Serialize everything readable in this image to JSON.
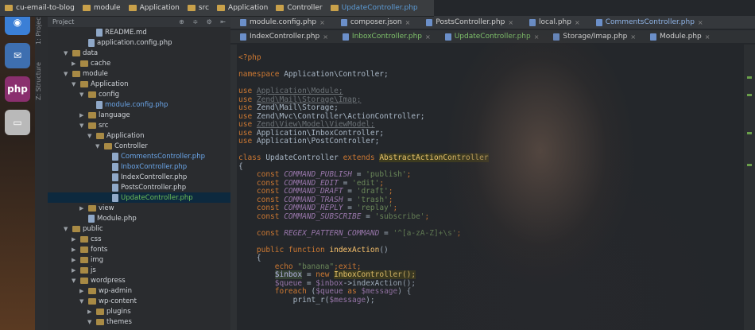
{
  "breadcrumb": [
    {
      "label": "cu-email-to-blog",
      "active": false
    },
    {
      "label": "module",
      "active": false
    },
    {
      "label": "Application",
      "active": false
    },
    {
      "label": "src",
      "active": false
    },
    {
      "label": "Application",
      "active": false
    },
    {
      "label": "Controller",
      "active": false
    },
    {
      "label": "UpdateController.php",
      "active": true
    }
  ],
  "project_panel": {
    "header": "Project",
    "tools": "⊕ ≑ ⚙ ⇤",
    "tree": [
      {
        "label": "README.md",
        "depth": 5,
        "kind": "file",
        "style": ""
      },
      {
        "label": "application.config.php",
        "depth": 4,
        "kind": "file",
        "style": ""
      },
      {
        "label": "data",
        "depth": 2,
        "kind": "folder",
        "arrow": "▼",
        "style": ""
      },
      {
        "label": "cache",
        "depth": 3,
        "kind": "folder",
        "arrow": "▶",
        "style": ""
      },
      {
        "label": "module",
        "depth": 2,
        "kind": "folder",
        "arrow": "▼",
        "style": ""
      },
      {
        "label": "Application",
        "depth": 3,
        "kind": "folder",
        "arrow": "▼",
        "style": ""
      },
      {
        "label": "config",
        "depth": 4,
        "kind": "folder",
        "arrow": "▼",
        "style": ""
      },
      {
        "label": "module.config.php",
        "depth": 5,
        "kind": "file",
        "style": "blue"
      },
      {
        "label": "language",
        "depth": 4,
        "kind": "folder",
        "arrow": "▶",
        "style": ""
      },
      {
        "label": "src",
        "depth": 4,
        "kind": "folder",
        "arrow": "▼",
        "style": ""
      },
      {
        "label": "Application",
        "depth": 5,
        "kind": "folder",
        "arrow": "▼",
        "style": ""
      },
      {
        "label": "Controller",
        "depth": 6,
        "kind": "folder",
        "arrow": "▼",
        "style": ""
      },
      {
        "label": "CommentsController.php",
        "depth": 7,
        "kind": "file",
        "style": "blue"
      },
      {
        "label": "InboxController.php",
        "depth": 7,
        "kind": "file",
        "style": "blue"
      },
      {
        "label": "IndexController.php",
        "depth": 7,
        "kind": "file",
        "style": ""
      },
      {
        "label": "PostsController.php",
        "depth": 7,
        "kind": "file",
        "style": ""
      },
      {
        "label": "UpdateController.php",
        "depth": 7,
        "kind": "file",
        "style": "green sel"
      },
      {
        "label": "view",
        "depth": 4,
        "kind": "folder",
        "arrow": "▶",
        "style": ""
      },
      {
        "label": "Module.php",
        "depth": 4,
        "kind": "file",
        "style": ""
      },
      {
        "label": "public",
        "depth": 2,
        "kind": "folder",
        "arrow": "▼",
        "style": ""
      },
      {
        "label": "css",
        "depth": 3,
        "kind": "folder",
        "arrow": "▶",
        "style": ""
      },
      {
        "label": "fonts",
        "depth": 3,
        "kind": "folder",
        "arrow": "▶",
        "style": ""
      },
      {
        "label": "img",
        "depth": 3,
        "kind": "folder",
        "arrow": "▶",
        "style": ""
      },
      {
        "label": "js",
        "depth": 3,
        "kind": "folder",
        "arrow": "▶",
        "style": ""
      },
      {
        "label": "wordpress",
        "depth": 3,
        "kind": "folder",
        "arrow": "▼",
        "style": ""
      },
      {
        "label": "wp-admin",
        "depth": 4,
        "kind": "folder",
        "arrow": "▶",
        "style": ""
      },
      {
        "label": "wp-content",
        "depth": 4,
        "kind": "folder",
        "arrow": "▼",
        "style": ""
      },
      {
        "label": "plugins",
        "depth": 5,
        "kind": "folder",
        "arrow": "▶",
        "style": ""
      },
      {
        "label": "themes",
        "depth": 5,
        "kind": "folder",
        "arrow": "▼",
        "style": ""
      }
    ]
  },
  "side_rail": {
    "items": [
      "1: Project",
      "Z: Structure"
    ]
  },
  "launcher": {
    "items": [
      {
        "icon": "chromium-icon",
        "glyph": "◉",
        "color": "#3b7fd6"
      },
      {
        "icon": "thunderbird-icon",
        "glyph": "✉",
        "color": "#3e6fb0"
      },
      {
        "icon": "phpstorm-icon",
        "glyph": "php",
        "color": "#8a2f6e"
      },
      {
        "icon": "drive-icon",
        "glyph": "▭",
        "color": "#b9b9b9"
      }
    ]
  },
  "tabs_row1": [
    {
      "label": "module.config.php",
      "style": ""
    },
    {
      "label": "composer.json",
      "style": ""
    },
    {
      "label": "PostsController.php",
      "style": ""
    },
    {
      "label": "local.php",
      "style": ""
    },
    {
      "label": "CommentsController.php",
      "style": "blue"
    }
  ],
  "tabs_row2": [
    {
      "label": "IndexController.php",
      "style": ""
    },
    {
      "label": "InboxController.php",
      "style": "green"
    },
    {
      "label": "UpdateController.php",
      "style": "green"
    },
    {
      "label": "Storage/Imap.php",
      "style": ""
    },
    {
      "label": "Module.php",
      "style": ""
    }
  ],
  "code_lines": [
    [
      {
        "t": "<?php",
        "c": "kw"
      }
    ],
    [],
    [
      {
        "t": "namespace ",
        "c": "kw"
      },
      {
        "t": "Application\\Controller;",
        "c": "ns"
      }
    ],
    [],
    [
      {
        "t": "use ",
        "c": "kw"
      },
      {
        "t": "Application\\Module;",
        "c": "dim"
      }
    ],
    [
      {
        "t": "use ",
        "c": "kw"
      },
      {
        "t": "Zend\\Mail\\Storage\\Imap;",
        "c": "dim"
      }
    ],
    [
      {
        "t": "use ",
        "c": "kw"
      },
      {
        "t": "Zend\\Mail\\Storage;",
        "c": "ns"
      }
    ],
    [
      {
        "t": "use ",
        "c": "kw"
      },
      {
        "t": "Zend\\Mvc\\Controller\\ActionController;",
        "c": "ns"
      }
    ],
    [
      {
        "t": "use ",
        "c": "kw"
      },
      {
        "t": "Zend\\View\\Model\\ViewModel;",
        "c": "dim"
      }
    ],
    [
      {
        "t": "use ",
        "c": "kw"
      },
      {
        "t": "Application\\InboxController;",
        "c": "ns"
      }
    ],
    [
      {
        "t": "use ",
        "c": "kw"
      },
      {
        "t": "Application\\PostController;",
        "c": "ns"
      }
    ],
    [],
    [
      {
        "t": "class ",
        "c": "kw"
      },
      {
        "t": "UpdateController ",
        "c": "ns"
      },
      {
        "t": "extends ",
        "c": "kw"
      },
      {
        "t": "AbstractActionController",
        "c": "hl"
      }
    ],
    [
      {
        "t": "{",
        "c": "ns"
      }
    ],
    [
      {
        "t": "    const ",
        "c": "kw"
      },
      {
        "t": "COMMAND_PUBLISH",
        "c": "cst"
      },
      {
        "t": " = ",
        "c": "ns"
      },
      {
        "t": "'publish'",
        "c": "str"
      },
      {
        "t": ";",
        "c": "kw"
      }
    ],
    [
      {
        "t": "    const ",
        "c": "kw"
      },
      {
        "t": "COMMAND_EDIT",
        "c": "cst"
      },
      {
        "t": " = ",
        "c": "ns"
      },
      {
        "t": "'edit'",
        "c": "str"
      },
      {
        "t": ";",
        "c": "kw"
      }
    ],
    [
      {
        "t": "    const ",
        "c": "kw"
      },
      {
        "t": "COMMAND_DRAFT",
        "c": "cst"
      },
      {
        "t": " = ",
        "c": "ns"
      },
      {
        "t": "'draft'",
        "c": "str"
      },
      {
        "t": ";",
        "c": "kw"
      }
    ],
    [
      {
        "t": "    const ",
        "c": "kw"
      },
      {
        "t": "COMMAND_TRASH",
        "c": "cst"
      },
      {
        "t": " = ",
        "c": "ns"
      },
      {
        "t": "'trash'",
        "c": "str"
      },
      {
        "t": ";",
        "c": "kw"
      }
    ],
    [
      {
        "t": "    const ",
        "c": "kw"
      },
      {
        "t": "COMMAND_REPLY",
        "c": "cst"
      },
      {
        "t": " = ",
        "c": "ns"
      },
      {
        "t": "'replay'",
        "c": "str"
      },
      {
        "t": ";",
        "c": "kw"
      }
    ],
    [
      {
        "t": "    const ",
        "c": "kw"
      },
      {
        "t": "COMMAND_SUBSCRIBE",
        "c": "cst"
      },
      {
        "t": " = ",
        "c": "ns"
      },
      {
        "t": "'subscribe'",
        "c": "str"
      },
      {
        "t": ";",
        "c": "kw"
      }
    ],
    [],
    [
      {
        "t": "    const ",
        "c": "kw"
      },
      {
        "t": "REGEX_PATTERN_COMMAND",
        "c": "cst"
      },
      {
        "t": " = ",
        "c": "ns"
      },
      {
        "t": "'^[a-zA-Z]+\\s'",
        "c": "str"
      },
      {
        "t": ";",
        "c": "kw"
      }
    ],
    [],
    [
      {
        "t": "    public function ",
        "c": "kw"
      },
      {
        "t": "indexAction",
        "c": "fn"
      },
      {
        "t": "()",
        "c": "ns"
      }
    ],
    [
      {
        "t": "    {",
        "c": "ns"
      }
    ],
    [
      {
        "t": "        echo ",
        "c": "kw"
      },
      {
        "t": "\"banana\"",
        "c": "str"
      },
      {
        "t": ";",
        "c": "kw"
      },
      {
        "t": "exit",
        "c": "kw"
      },
      {
        "t": ";",
        "c": "kw"
      }
    ],
    [
      {
        "t": "        ",
        "c": "ns"
      },
      {
        "t": "$inbox",
        "c": "hvar"
      },
      {
        "t": " = ",
        "c": "ns"
      },
      {
        "t": "new ",
        "c": "kw"
      },
      {
        "t": "InboxController();",
        "c": "hl"
      }
    ],
    [
      {
        "t": "        ",
        "c": "ns"
      },
      {
        "t": "$queue",
        "c": "var"
      },
      {
        "t": " = ",
        "c": "ns"
      },
      {
        "t": "$inbox",
        "c": "var"
      },
      {
        "t": "->indexAction();",
        "c": "ns"
      }
    ],
    [
      {
        "t": "        foreach ",
        "c": "kw"
      },
      {
        "t": "(",
        "c": "ns"
      },
      {
        "t": "$queue",
        "c": "var"
      },
      {
        "t": " as ",
        "c": "kw"
      },
      {
        "t": "$message",
        "c": "var"
      },
      {
        "t": ") {",
        "c": "ns"
      }
    ],
    [
      {
        "t": "            print_r(",
        "c": "ns"
      },
      {
        "t": "$message",
        "c": "var"
      },
      {
        "t": ");",
        "c": "ns"
      }
    ]
  ]
}
